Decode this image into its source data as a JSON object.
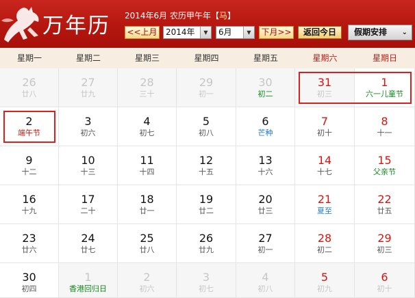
{
  "header": {
    "app_title": "万年历",
    "date_text": "2014年6月 农历甲午年【",
    "zodiac": "马",
    "date_close": "】",
    "prev_month": "<<上月",
    "year_value": "2014年",
    "month_value": "6月",
    "next_month": "下月>>",
    "today": "返回今日",
    "holiday_menu": "假期安排"
  },
  "weekdays": [
    "星期一",
    "星期二",
    "星期三",
    "星期四",
    "星期五",
    "星期六",
    "星期日"
  ],
  "weeks": [
    [
      {
        "day": "26",
        "sub": "廿八",
        "other": true
      },
      {
        "day": "27",
        "sub": "廿九",
        "other": true
      },
      {
        "day": "28",
        "sub": "三十",
        "other": true
      },
      {
        "day": "29",
        "sub": "初一",
        "other": true
      },
      {
        "day": "30",
        "sub": "初二",
        "other": true,
        "sub_type": "green"
      },
      {
        "day": "31",
        "sub": "初三",
        "other": true
      },
      {
        "day": "1",
        "sub": "六一儿童节",
        "sub_type": "green"
      }
    ],
    [
      {
        "day": "2",
        "sub": "端午节",
        "sub_type": "red"
      },
      {
        "day": "3",
        "sub": "初六"
      },
      {
        "day": "4",
        "sub": "初七"
      },
      {
        "day": "5",
        "sub": "初八"
      },
      {
        "day": "6",
        "sub": "芒种",
        "sub_type": "solar"
      },
      {
        "day": "7",
        "sub": "初十"
      },
      {
        "day": "8",
        "sub": "十一"
      }
    ],
    [
      {
        "day": "9",
        "sub": "十二"
      },
      {
        "day": "10",
        "sub": "十三"
      },
      {
        "day": "11",
        "sub": "十四"
      },
      {
        "day": "12",
        "sub": "十五"
      },
      {
        "day": "13",
        "sub": "十六"
      },
      {
        "day": "14",
        "sub": "十七"
      },
      {
        "day": "15",
        "sub": "父亲节",
        "sub_type": "green"
      }
    ],
    [
      {
        "day": "16",
        "sub": "十九"
      },
      {
        "day": "17",
        "sub": "二十"
      },
      {
        "day": "18",
        "sub": "廿一"
      },
      {
        "day": "19",
        "sub": "廿二"
      },
      {
        "day": "20",
        "sub": "廿三"
      },
      {
        "day": "21",
        "sub": "夏至",
        "sub_type": "solar"
      },
      {
        "day": "22",
        "sub": "廿五"
      }
    ],
    [
      {
        "day": "23",
        "sub": "廿六"
      },
      {
        "day": "24",
        "sub": "廿七"
      },
      {
        "day": "25",
        "sub": "廿八"
      },
      {
        "day": "26",
        "sub": "廿九"
      },
      {
        "day": "27",
        "sub": "初一"
      },
      {
        "day": "28",
        "sub": "初二"
      },
      {
        "day": "29",
        "sub": "初三"
      }
    ],
    [
      {
        "day": "30",
        "sub": "初四"
      },
      {
        "day": "1",
        "sub": "香港回归日",
        "other": true,
        "sub_type": "green"
      },
      {
        "day": "2",
        "sub": "初六",
        "other": true
      },
      {
        "day": "3",
        "sub": "初七",
        "other": true
      },
      {
        "day": "4",
        "sub": "初八",
        "other": true
      },
      {
        "day": "5",
        "sub": "初九",
        "other": true
      },
      {
        "day": "6",
        "sub": "初十",
        "other": true
      }
    ]
  ],
  "highlights": [
    {
      "week": 0,
      "from": 5,
      "to": 6
    },
    {
      "week": 1,
      "from": 0,
      "to": 0
    }
  ],
  "colors": {
    "header_red": "#b4170f",
    "weekend_red": "#d8140e",
    "festival_green": "#138a1f",
    "solar_term_blue": "#1f79c8",
    "highlight_border": "#d9211b"
  }
}
